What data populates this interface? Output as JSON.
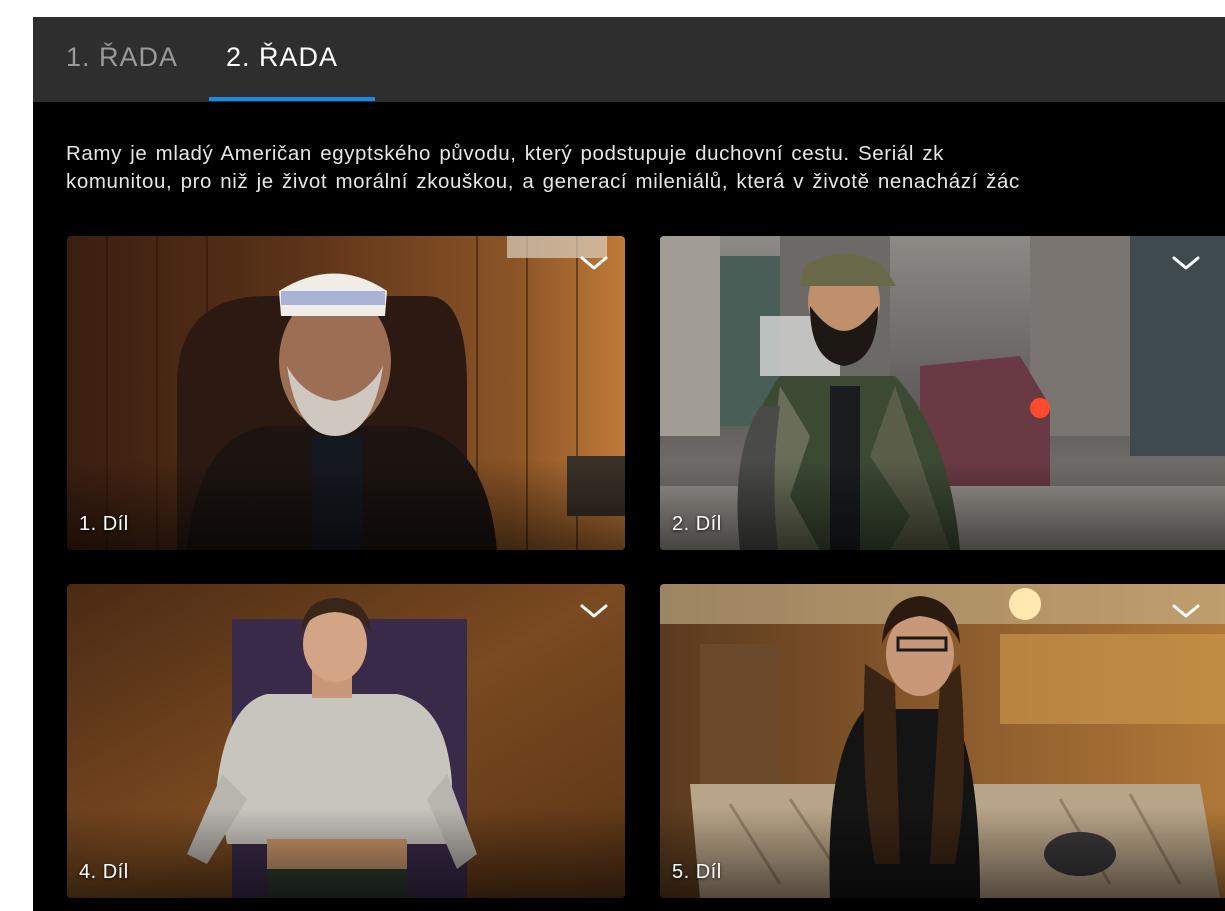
{
  "tabs": [
    {
      "label": "1. ŘADA",
      "selected": false
    },
    {
      "label": "2. ŘADA",
      "selected": true
    }
  ],
  "accent_color": "#1e88e5",
  "description": {
    "line1": "Ramy je mladý Američan egyptského původu, který podstupuje duchovní cestu. Seriál zk",
    "line2": "komunitou, pro niž je život morální zkouškou, a generací mileniálů, která v životě nenachází žác"
  },
  "episodes": [
    {
      "label": "1. Díl",
      "expand_icon": "chevron-down-icon"
    },
    {
      "label": "2. Díl",
      "expand_icon": "chevron-down-icon"
    },
    {
      "label": "4. Díl",
      "expand_icon": "chevron-down-icon"
    },
    {
      "label": "5. Díl",
      "expand_icon": "chevron-down-icon"
    }
  ]
}
